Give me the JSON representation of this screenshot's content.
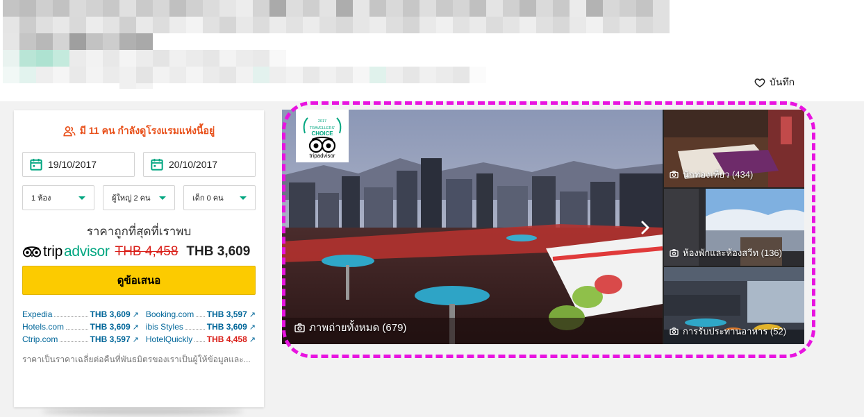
{
  "header": {
    "save_label": "บันทึก",
    "save_icon": "heart-icon"
  },
  "booking": {
    "viewers_text": "มี 11 คน กำลังดูโรงแรมแห่งนี้อยู่",
    "checkin": "19/10/2017",
    "checkout": "20/10/2017",
    "rooms": "1 ห้อง",
    "adults": "ผู้ใหญ่ 2 คน",
    "children": "เด็ก 0 คน",
    "cheapest_label": "ราคาถูกที่สุดที่เราพบ",
    "brand_prefix": "trip",
    "brand_suffix": "advisor",
    "old_price": "THB 4,458",
    "new_price": "THB 3,609",
    "deal_button": "ดูข้อเสนอ",
    "offers": [
      {
        "name": "Expedia",
        "price": "THB 3,609",
        "highlight": false
      },
      {
        "name": "Booking.com",
        "price": "THB 3,597",
        "highlight": false
      },
      {
        "name": "Hotels.com",
        "price": "THB 3,609",
        "highlight": false
      },
      {
        "name": "ibis Styles",
        "price": "THB 3,609",
        "highlight": false
      },
      {
        "name": "Ctrip.com",
        "price": "THB 3,597",
        "highlight": false
      },
      {
        "name": "HotelQuickly",
        "price": "THB 4,458",
        "highlight": true
      }
    ],
    "disclaimer": "ราคาเป็นราคาเฉลี่ยต่อคืนที่พันธมิตรของเราเป็นผู้ให้ข้อมูลและ..."
  },
  "gallery": {
    "badge_year": "2017",
    "badge_line1": "TRAVELLERS'",
    "badge_line2": "CHOICE",
    "badge_brand": "tripadvisor",
    "all_photos": "ภาพถ่ายทั้งหมด (679)",
    "thumbs": [
      {
        "label": "นักท่องเที่ยว (434)"
      },
      {
        "label": "ห้องพักและห้องสวีท (136)"
      },
      {
        "label": "การรับประทานอาหาร (52)"
      }
    ]
  },
  "colors": {
    "accent_green": "#00a680",
    "deal_yellow": "#fccb00",
    "price_red": "#d91e18",
    "link_blue": "#006699",
    "highlight_magenta": "#e814e0"
  }
}
